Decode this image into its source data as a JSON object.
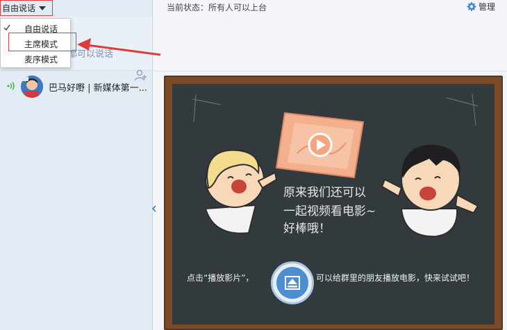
{
  "left_panel": {
    "mode_button_label": "自由说话",
    "hint_text": "都可以说话",
    "dropdown": {
      "items": [
        {
          "label": "自由说话",
          "checked": true
        },
        {
          "label": "主席模式",
          "checked": false
        },
        {
          "label": "麦序模式",
          "checked": false
        }
      ]
    },
    "members": [
      {
        "name": "巴马好嘢 | 新媒体第一..."
      }
    ]
  },
  "right_panel": {
    "status_text": "当前状态：所有人可以上台",
    "manage_label": "管理",
    "board": {
      "chalk_line_1": "原来我们还可以",
      "chalk_line_2": "一起视频看电影~",
      "chalk_line_3": "好棒哦！",
      "caption_left": "点击“播放影片”，",
      "caption_right": "可以给群里的朋友播放电影，快来试试吧！"
    }
  },
  "colors": {
    "highlight_red": "#e03a3a",
    "accent_blue": "#4c8ed0",
    "board_green": "#323a3d",
    "frame_brown": "#7b4a27"
  },
  "icons": {
    "check": "checkmark-icon",
    "caret": "caret-down-icon",
    "manage": "gear-icon",
    "signal": "speaking-signal-icon",
    "add_member": "add-user-icon",
    "play": "eject-play-icon"
  }
}
